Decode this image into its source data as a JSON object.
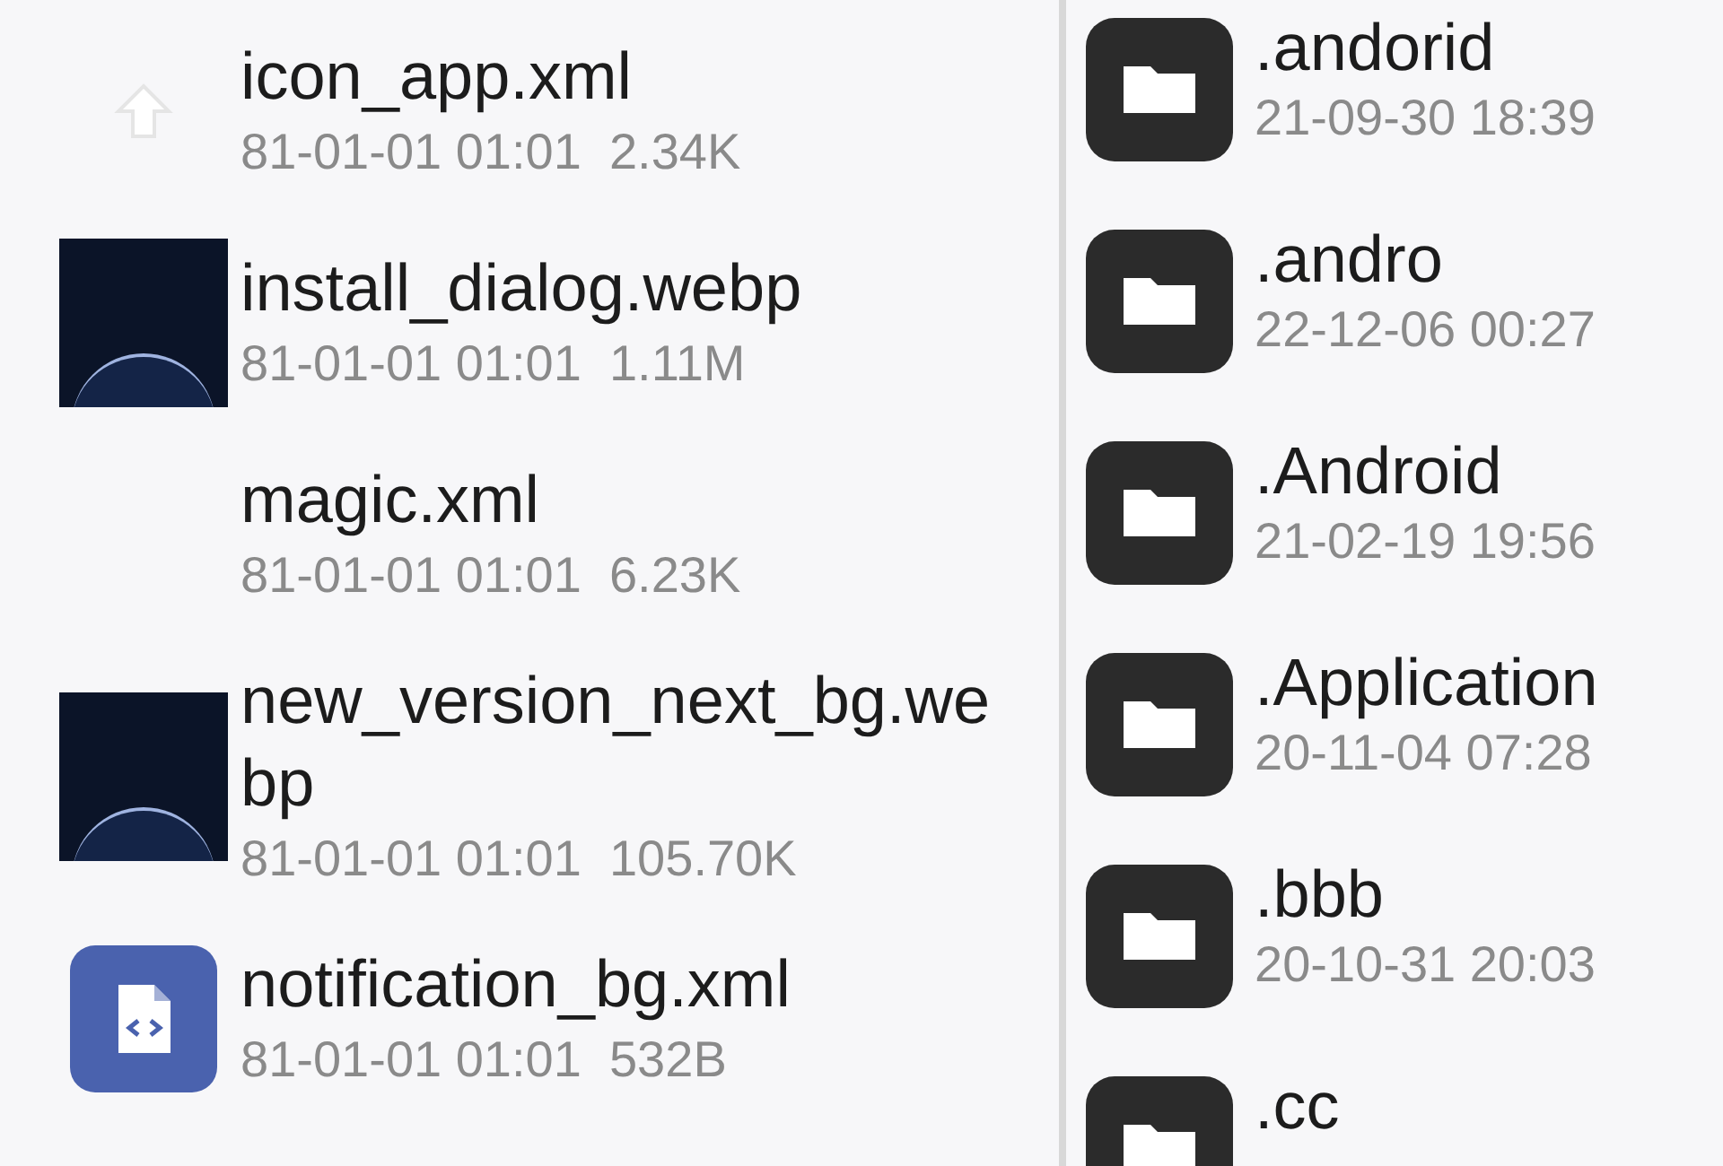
{
  "files": [
    {
      "kind": "arrow",
      "name": "icon_app.xml",
      "date": "81-01-01 01:01",
      "size": "2.34K"
    },
    {
      "kind": "image",
      "name": "install_dialog.webp",
      "date": "81-01-01 01:01",
      "size": "1.11M"
    },
    {
      "kind": "none",
      "name": "magic.xml",
      "date": "81-01-01 01:01",
      "size": "6.23K"
    },
    {
      "kind": "image",
      "name": "new_version_next_bg.webp",
      "date": "81-01-01 01:01",
      "size": "105.70K"
    },
    {
      "kind": "code",
      "name": "notification_bg.xml",
      "date": "81-01-01 01:01",
      "size": "532B"
    }
  ],
  "folders": [
    {
      "name": ".andorid",
      "date": "21-09-30 18:39"
    },
    {
      "name": ".andro",
      "date": "22-12-06 00:27"
    },
    {
      "name": ".Android",
      "date": "21-02-19 19:56"
    },
    {
      "name": ".Application",
      "date": "20-11-04 07:28"
    },
    {
      "name": ".bbb",
      "date": "20-10-31 20:03"
    },
    {
      "name": ".cc"
    }
  ]
}
